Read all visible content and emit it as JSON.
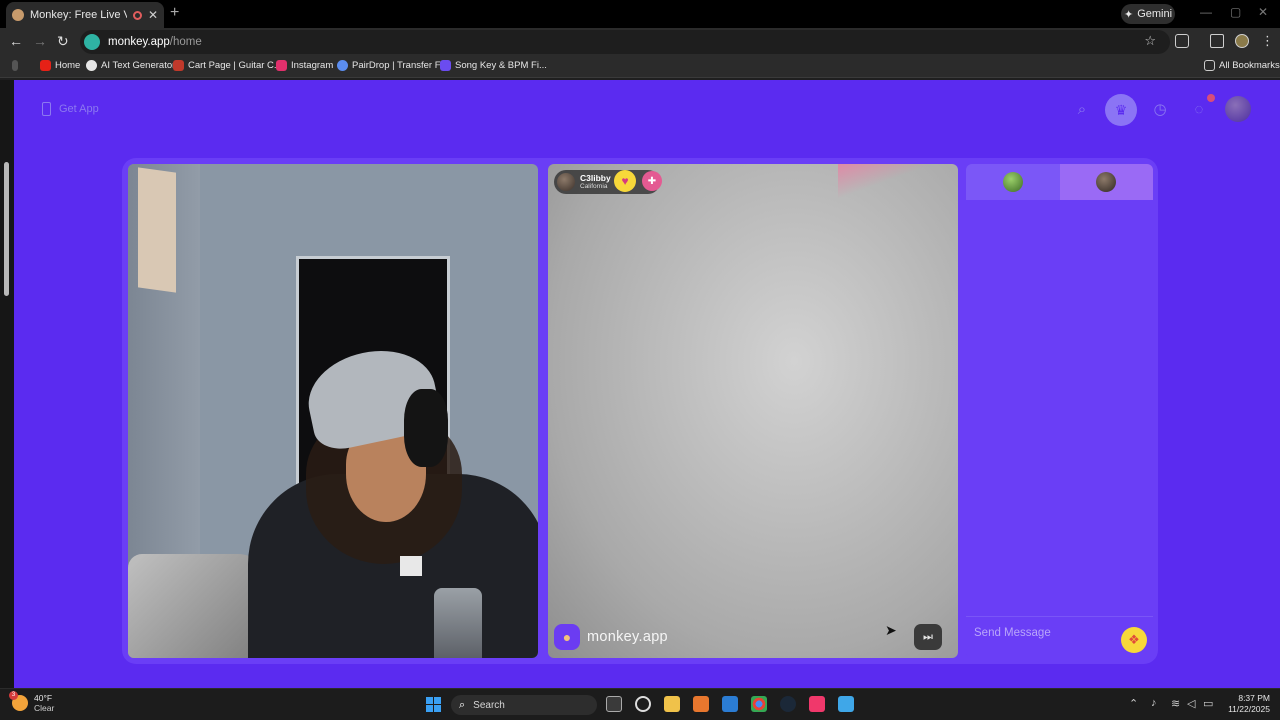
{
  "browser": {
    "tab_title": "Monkey: Free Live Video Ch",
    "gemini_label": "Gemini",
    "url_host": "monkey.app",
    "url_path": "/home",
    "bookmarks": [
      {
        "label": "Home",
        "icon": "youtube-icon",
        "color": "#e62117"
      },
      {
        "label": "AI Text Generator",
        "icon": "ai-icon",
        "color": "#e6e6e6"
      },
      {
        "label": "Cart Page | Guitar C...",
        "icon": "cart-icon",
        "color": "#c0392b"
      },
      {
        "label": "Instagram",
        "icon": "instagram-icon",
        "color": "#e1306c"
      },
      {
        "label": "PairDrop | Transfer F...",
        "icon": "pairdrop-icon",
        "color": "#5b8def"
      },
      {
        "label": "Song Key & BPM Fi...",
        "icon": "music-icon",
        "color": "#6b4cf0"
      }
    ],
    "all_bookmarks_label": "All Bookmarks"
  },
  "header": {
    "get_app_label": "Get App",
    "icons": [
      "search-icon",
      "crown-icon",
      "history-icon",
      "chat-icon",
      "profile-avatar"
    ]
  },
  "remote_user": {
    "name": "C3libby",
    "location": "California"
  },
  "video": {
    "brand_text": "monkey.app"
  },
  "chat": {
    "input_placeholder": "Send Message"
  },
  "taskbar": {
    "weather_temp": "40°F",
    "weather_desc": "Clear",
    "weather_badge": "3",
    "search_label": "Search",
    "time": "8:37 PM",
    "date": "11/22/2025"
  },
  "colors": {
    "page_bg": "#5b2bf0",
    "panel": "#6a3ef6",
    "accent_yellow": "#f7d83a"
  }
}
